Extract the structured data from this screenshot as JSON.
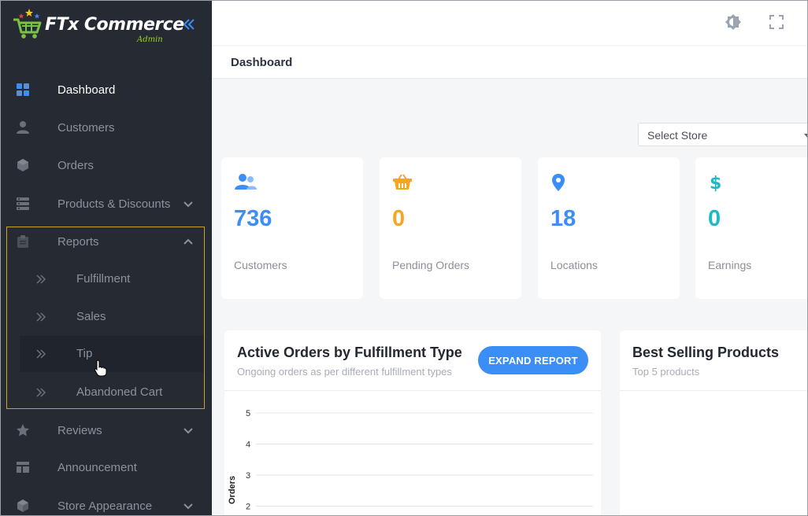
{
  "brand": {
    "name": "FTx Commerce",
    "sub": "Admin"
  },
  "sidebar": {
    "items": [
      {
        "label": "Dashboard",
        "icon": "grid-icon",
        "active": true
      },
      {
        "label": "Customers",
        "icon": "user-icon"
      },
      {
        "label": "Orders",
        "icon": "box-icon"
      },
      {
        "label": "Products & Discounts",
        "icon": "server-icon",
        "expandable": true
      },
      {
        "label": "Reports",
        "icon": "clipboard-icon",
        "expanded": true
      },
      {
        "label": "Reviews",
        "icon": "star-icon",
        "expandable": true
      },
      {
        "label": "Announcement",
        "icon": "layout-icon"
      },
      {
        "label": "Store Appearance",
        "icon": "cube-icon",
        "expandable": true
      }
    ],
    "reports_sub": [
      {
        "label": "Fulfillment"
      },
      {
        "label": "Sales"
      },
      {
        "label": "Tip"
      },
      {
        "label": "Abandoned Cart"
      }
    ]
  },
  "header": {
    "title": "Dashboard"
  },
  "store_select": {
    "value": "Select Store"
  },
  "stats": [
    {
      "value": "736",
      "caption": "Customers",
      "color": "#3a8ef6",
      "icon": "users-icon"
    },
    {
      "value": "0",
      "caption": "Pending Orders",
      "color": "#f5a623",
      "icon": "basket-icon"
    },
    {
      "value": "18",
      "caption": "Locations",
      "color": "#3a8ef6",
      "icon": "location-pin-icon"
    },
    {
      "value": "0",
      "caption": "Earnings",
      "color": "#1fb9c6",
      "icon": "dollar-icon"
    }
  ],
  "active_orders": {
    "title": "Active Orders by Fulfillment Type",
    "subtitle": "Ongoing orders as per different fulfillment types",
    "button": "EXPAND REPORT"
  },
  "best_selling": {
    "title": "Best Selling Products",
    "subtitle": "Top 5 products"
  },
  "chart_data": {
    "type": "bar",
    "categories": [],
    "values": [],
    "title": "",
    "ylabel": "Orders",
    "y_ticks": [
      "5",
      "4",
      "3",
      "2"
    ],
    "grid": true
  }
}
